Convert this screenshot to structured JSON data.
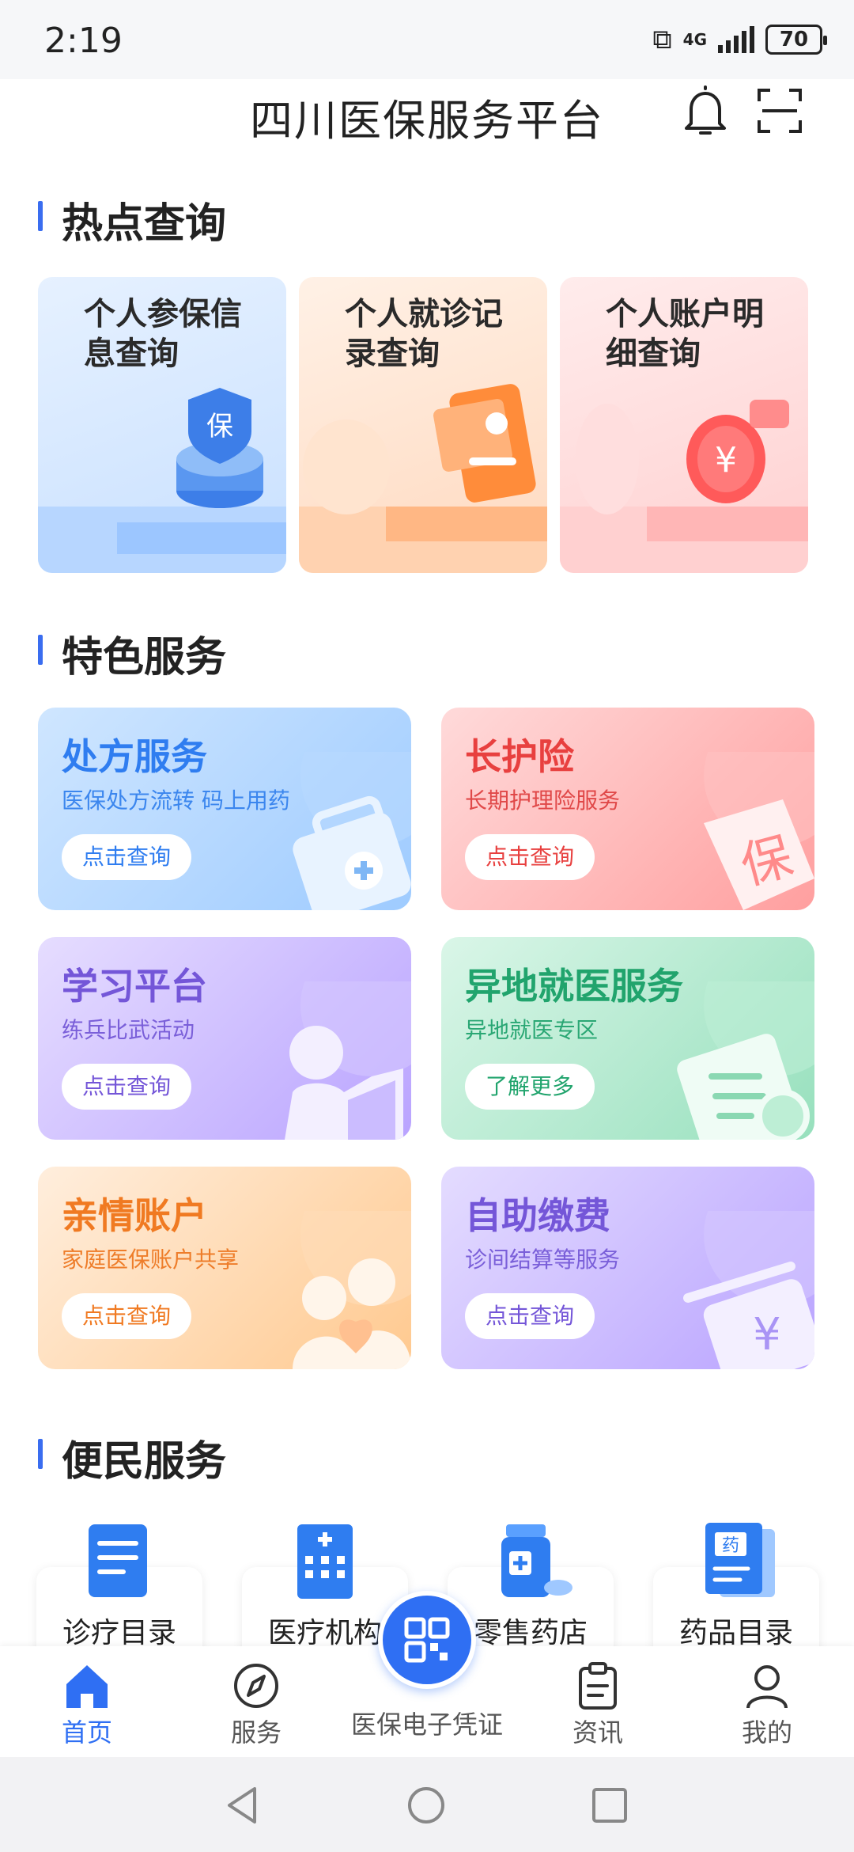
{
  "status": {
    "time": "2:19",
    "network": "4G",
    "battery": "70"
  },
  "header": {
    "title": "四川医保服务平台"
  },
  "hot": {
    "title": "热点查询",
    "cards": [
      {
        "label": "个人参保信息查询",
        "icon": "shield-bao-icon",
        "color": "#dcebff"
      },
      {
        "label": "个人就诊记录查询",
        "icon": "record-card-icon",
        "color": "#ffe6d2"
      },
      {
        "label": "个人账户明细查询",
        "icon": "yuan-coin-icon",
        "color": "#ffdede"
      }
    ]
  },
  "features": {
    "title": "特色服务",
    "cards": [
      {
        "title": "处方服务",
        "subtitle": "医保处方流转 码上用药",
        "button": "点击查询",
        "icon": "medical-kit-icon",
        "accent": "#2f7df0"
      },
      {
        "title": "长护险",
        "subtitle": "长期护理险服务",
        "button": "点击查询",
        "icon": "bao-tag-icon",
        "accent": "#e8403f"
      },
      {
        "title": "学习平台",
        "subtitle": "练兵比武活动",
        "button": "点击查询",
        "icon": "reader-icon",
        "accent": "#7456d8"
      },
      {
        "title": "异地就医服务",
        "subtitle": "异地就医专区",
        "button": "了解更多",
        "icon": "document-stamp-icon",
        "accent": "#21a46d"
      },
      {
        "title": "亲情账户",
        "subtitle": "家庭医保账户共享",
        "button": "点击查询",
        "icon": "family-icon",
        "accent": "#f07a22"
      },
      {
        "title": "自助缴费",
        "subtitle": "诊间结算等服务",
        "button": "点击查询",
        "icon": "payment-icon",
        "accent": "#7456d8"
      }
    ]
  },
  "convenience": {
    "title": "便民服务",
    "items": [
      {
        "label": "诊疗目录",
        "icon": "document-list-icon"
      },
      {
        "label": "医疗机构",
        "icon": "hospital-icon"
      },
      {
        "label": "零售药店",
        "icon": "medicine-bottle-icon"
      },
      {
        "label": "药品目录",
        "icon": "drug-book-icon"
      }
    ]
  },
  "tabbar": {
    "items": [
      {
        "label": "首页",
        "icon": "home-icon",
        "active": true
      },
      {
        "label": "服务",
        "icon": "compass-icon",
        "active": false
      },
      {
        "label": "医保电子凭证",
        "icon": "qr-code-icon",
        "active": false
      },
      {
        "label": "资讯",
        "icon": "clipboard-icon",
        "active": false
      },
      {
        "label": "我的",
        "icon": "user-icon",
        "active": false
      }
    ]
  },
  "colors": {
    "primary": "#2f6ff3"
  }
}
